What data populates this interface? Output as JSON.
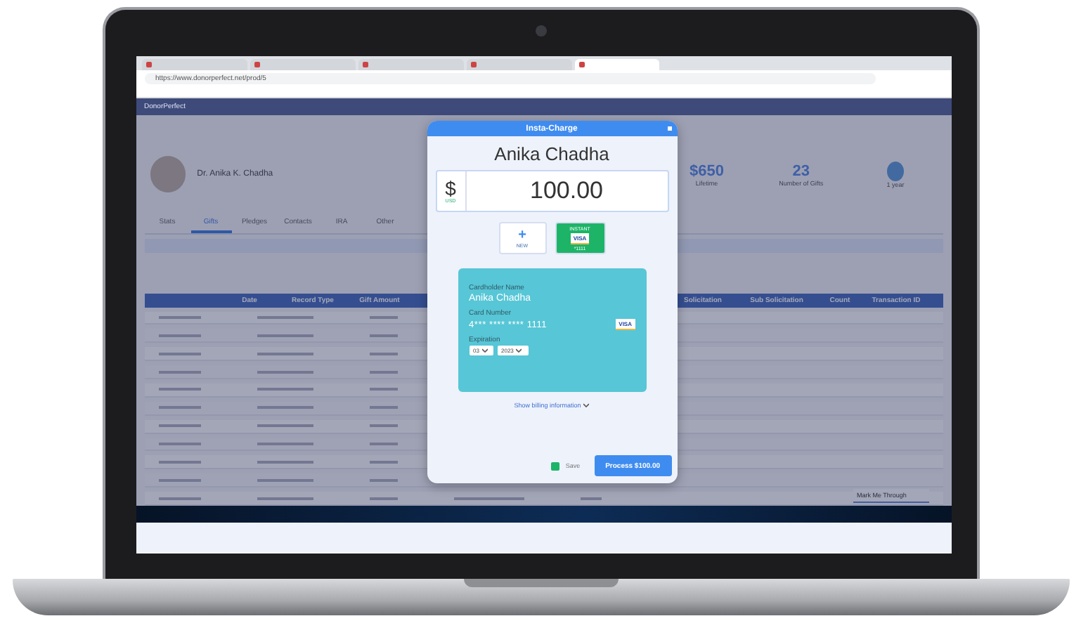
{
  "browser": {
    "tabs": [
      {
        "selected": false
      },
      {
        "selected": false
      },
      {
        "selected": false
      },
      {
        "selected": false
      },
      {
        "selected": true
      }
    ],
    "url": "https://www.donorperfect.net/prod/5"
  },
  "app": {
    "brand": "DonorPerfect"
  },
  "profile": {
    "name": "Dr. Anika K. Chadha",
    "stats": [
      {
        "value": "$650",
        "label": "Lifetime"
      },
      {
        "value": "23",
        "label": "Number of Gifts"
      }
    ],
    "badge": "1 year"
  },
  "tabs": [
    {
      "label": "Stats",
      "selected": false
    },
    {
      "label": "Gifts",
      "selected": true
    },
    {
      "label": "Pledges",
      "selected": false
    },
    {
      "label": "Contacts",
      "selected": false
    },
    {
      "label": "IRA",
      "selected": false
    },
    {
      "label": "Other",
      "selected": false
    }
  ],
  "table": {
    "columns": [
      "Date",
      "Record Type",
      "Gift Amount",
      "Solicitation",
      "Sub Solicitation",
      "Count",
      "Transaction ID"
    ]
  },
  "row_select": {
    "value": "Mark Me Through"
  },
  "modal": {
    "title": "Insta-Charge",
    "donor": "Anika Chadha",
    "currency_symbol": "$",
    "currency": "USD",
    "amount": "100.00",
    "payment_options": [
      {
        "kind": "new",
        "icon": "+",
        "label": "NEW",
        "selected": false
      },
      {
        "kind": "card",
        "top": "INSTANT",
        "brand": "VISA",
        "label": "*1111",
        "selected": true
      }
    ],
    "card": {
      "name_label": "Cardholder Name",
      "name": "Anika Chadha",
      "number_label": "Card Number",
      "number": "4*** **** **** 1111",
      "brand": "VISA",
      "expiration_label": "Expiration",
      "month": "03",
      "year": "2023"
    },
    "billing_link": "Show billing information",
    "save": {
      "label": "Save",
      "checked": true
    },
    "process_button": "Process $100.00"
  }
}
